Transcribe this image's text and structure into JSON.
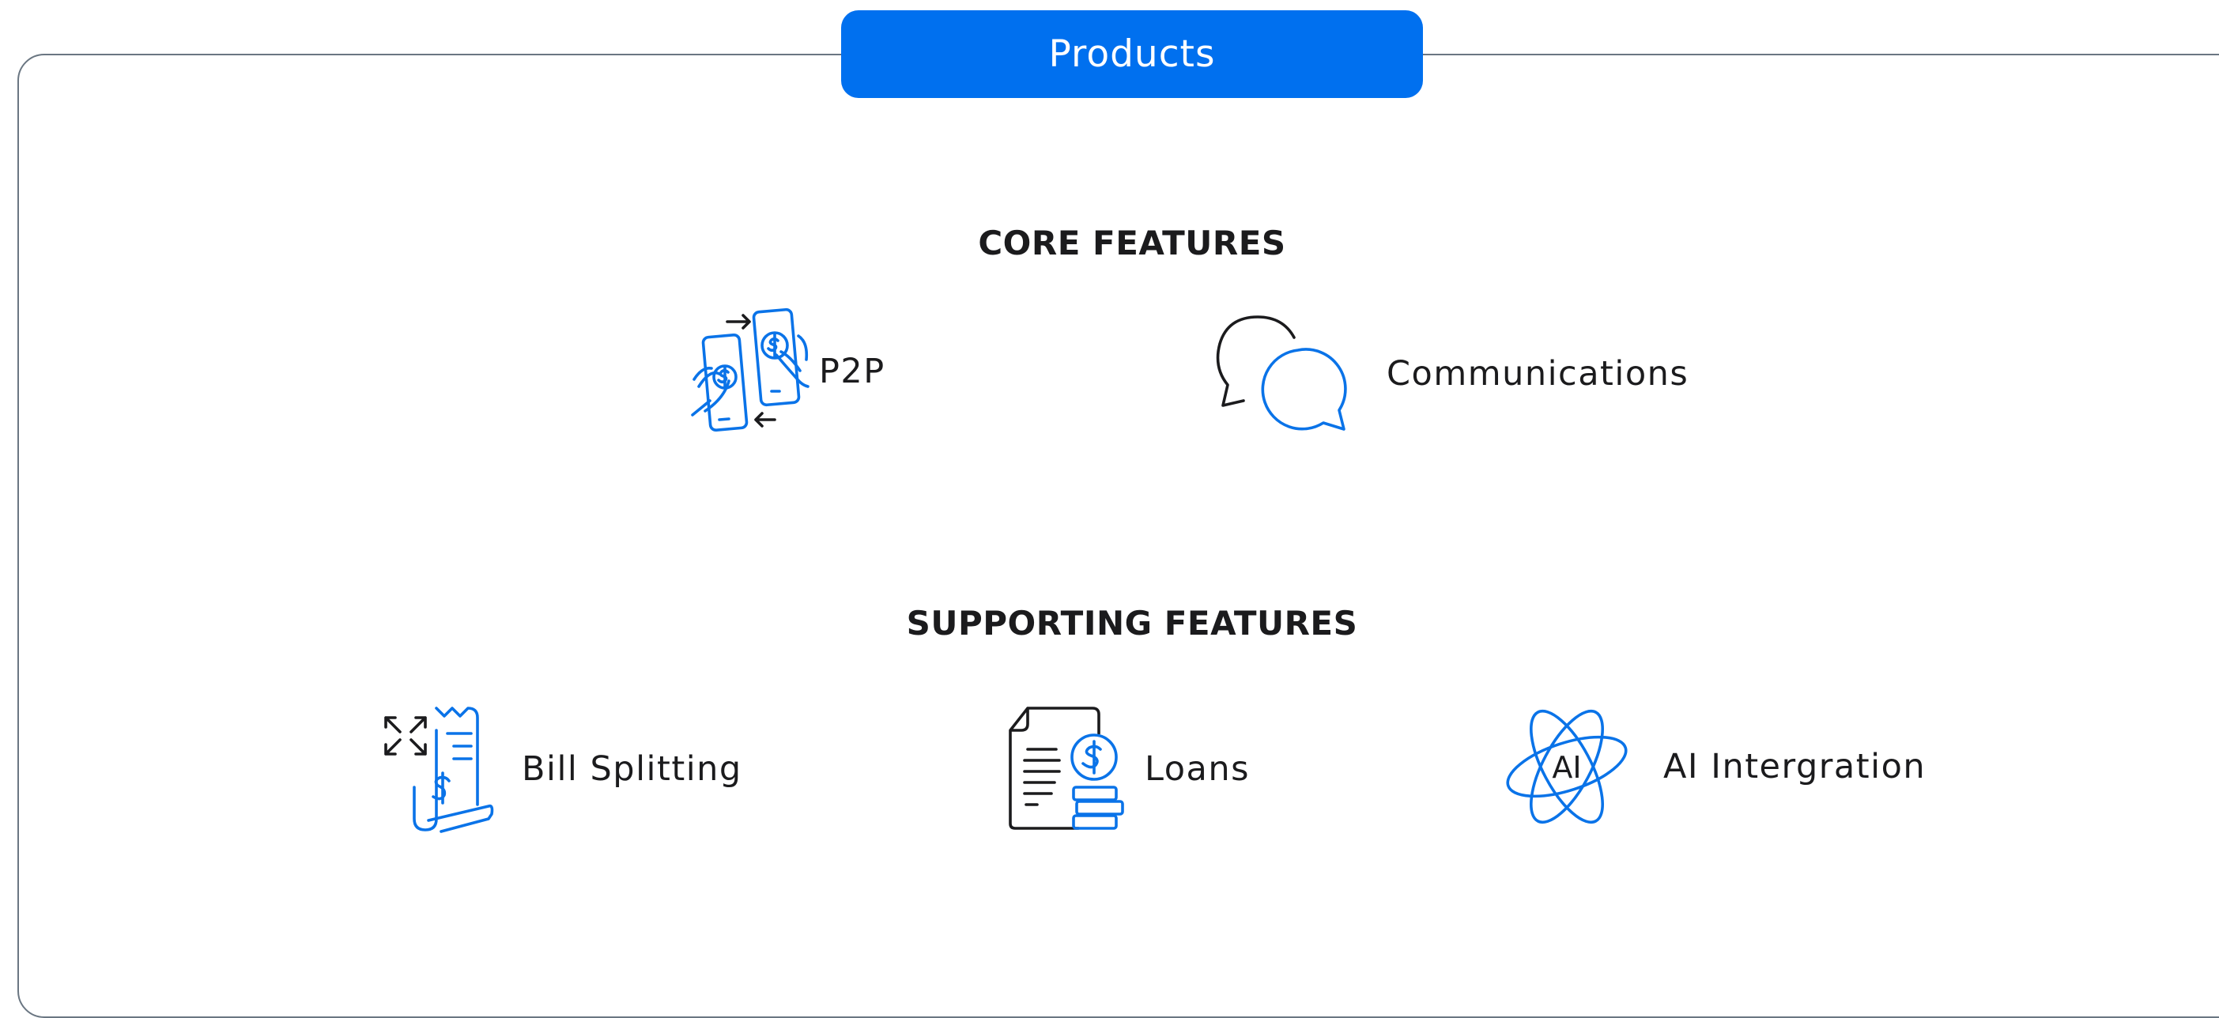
{
  "header": {
    "title": "Products"
  },
  "sections": [
    {
      "heading": "CORE FEATURES",
      "features": [
        {
          "label": "P2P",
          "icon": "p2p-phones-icon"
        },
        {
          "label": "Communications",
          "icon": "chat-bubbles-icon"
        }
      ]
    },
    {
      "heading": "SUPPORTING FEATURES",
      "features": [
        {
          "label": "Bill Splitting",
          "icon": "bill-split-icon"
        },
        {
          "label": "Loans",
          "icon": "loan-document-icon"
        },
        {
          "label": "AI Intergration",
          "icon": "ai-atom-icon",
          "icon_text": "AI"
        }
      ]
    }
  ],
  "colors": {
    "accent": "#0070ef",
    "icon_blue": "#0a73e8",
    "text": "#1b1b1d",
    "frame_border": "#6a7682"
  }
}
